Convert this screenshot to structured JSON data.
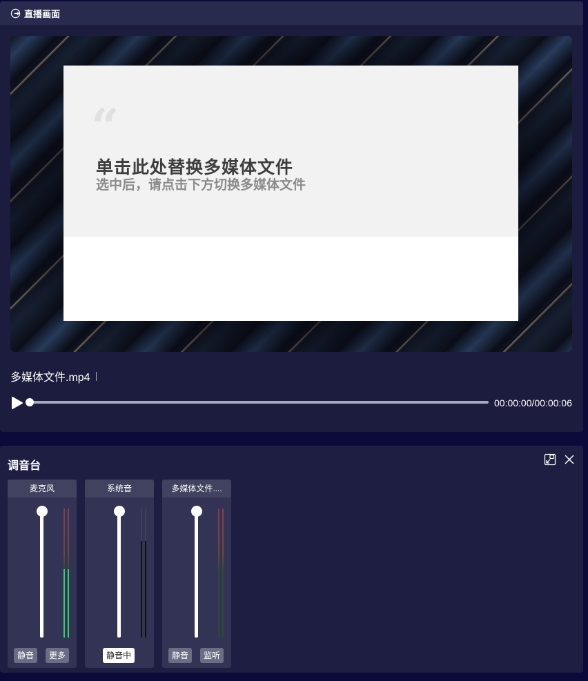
{
  "live": {
    "title": "直播画面",
    "placeholder": {
      "quote": "“",
      "title": "单击此处替换多媒体文件",
      "subtitle": "选中后，请点击下方切换多媒体文件"
    },
    "file_name": "多媒体文件.mp4",
    "progress": 0.0,
    "timecode": "00:00:00/00:00:06"
  },
  "mixer": {
    "title": "调音台",
    "channels": [
      {
        "name": "麦克风",
        "fader_level": 1.0,
        "meter_left": 0.53,
        "meter_right": 0.53,
        "buttons": [
          "静音",
          "更多"
        ],
        "active_button": -1
      },
      {
        "name": "系统音",
        "fader_level": 1.0,
        "meter_left": 0.75,
        "meter_right": 0.75,
        "buttons": [
          "静音中"
        ],
        "active_button": 0
      },
      {
        "name": "多媒体文件....",
        "fader_level": 1.0,
        "meter_left": 0.0,
        "meter_right": 0.0,
        "buttons": [
          "静音",
          "监听"
        ],
        "active_button": -1
      }
    ]
  },
  "colors": {
    "meter_green": "#33d16b",
    "meter_dark": "#111111",
    "panel": "#1c1c3e"
  }
}
